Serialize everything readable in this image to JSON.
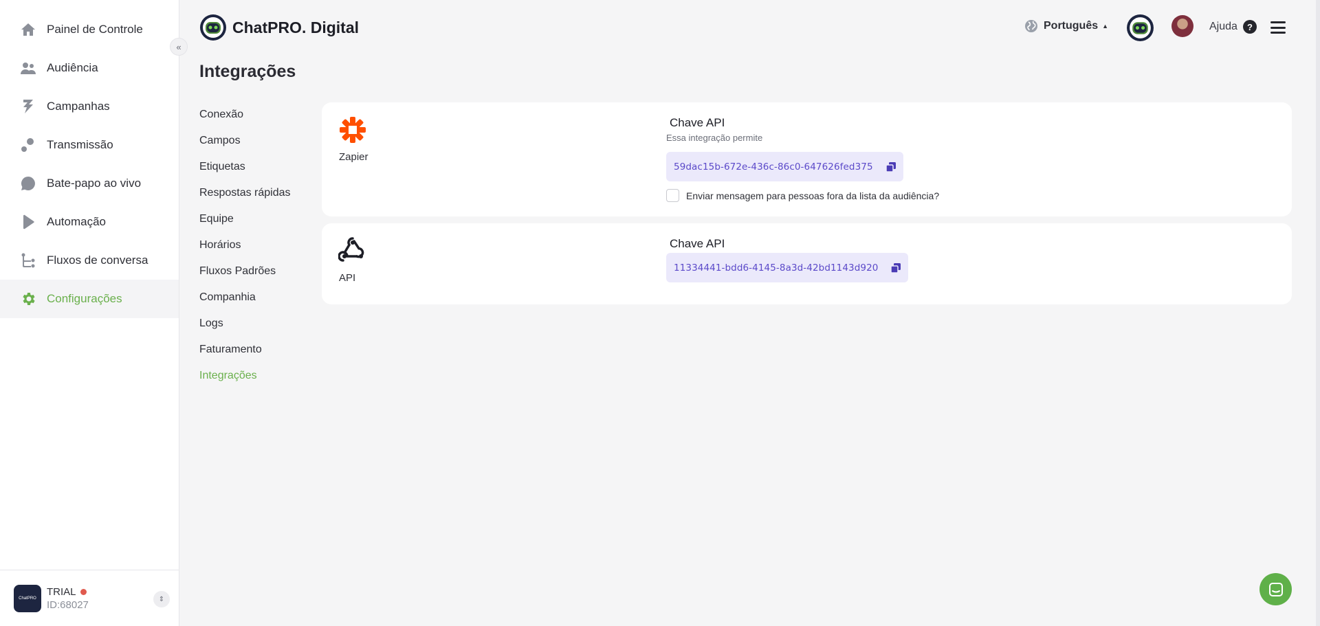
{
  "sidebar": {
    "items": [
      {
        "label": "Painel de Controle",
        "icon": "home-icon"
      },
      {
        "label": "Audiência",
        "icon": "users-icon"
      },
      {
        "label": "Campanhas",
        "icon": "campaign-icon"
      },
      {
        "label": "Transmissão",
        "icon": "broadcast-icon"
      },
      {
        "label": "Bate-papo ao vivo",
        "icon": "chat-icon"
      },
      {
        "label": "Automação",
        "icon": "automation-icon"
      },
      {
        "label": "Fluxos de conversa",
        "icon": "flow-icon"
      },
      {
        "label": "Configurações",
        "icon": "gear-icon",
        "active": true
      }
    ],
    "collapse_glyph": "«",
    "account": {
      "logo_text": "ChatPRO",
      "plan": "TRIAL",
      "id": "ID:68027",
      "switch_glyph": "⇕"
    }
  },
  "header": {
    "brand": "ChatPRO. Digital",
    "language": "Português",
    "help": "Ajuda",
    "help_glyph": "?"
  },
  "page": {
    "title": "Integrações"
  },
  "settings_nav": [
    "Conexão",
    "Campos",
    "Etiquetas",
    "Respostas rápidas",
    "Equipe",
    "Horários",
    "Fluxos Padrões",
    "Companhia",
    "Logs",
    "Faturamento",
    "Integrações"
  ],
  "settings_nav_active": "Integrações",
  "integrations": {
    "zapier": {
      "name": "Zapier",
      "key_title": "Chave API",
      "description": "Essa integração permite",
      "api_key": "59dac15b-672e-436c-86c0-647626fed375",
      "checkbox_label": "Enviar mensagem para pessoas fora da lista da audiência?",
      "checkbox_checked": false
    },
    "api": {
      "name": "API",
      "key_title": "Chave API",
      "api_key": "11334441-bdd6-4145-8a3d-42bd1143d920"
    }
  },
  "colors": {
    "accent_green": "#6ab04c",
    "key_purple": "#5b49c9",
    "zapier_orange": "#ff4f00"
  }
}
